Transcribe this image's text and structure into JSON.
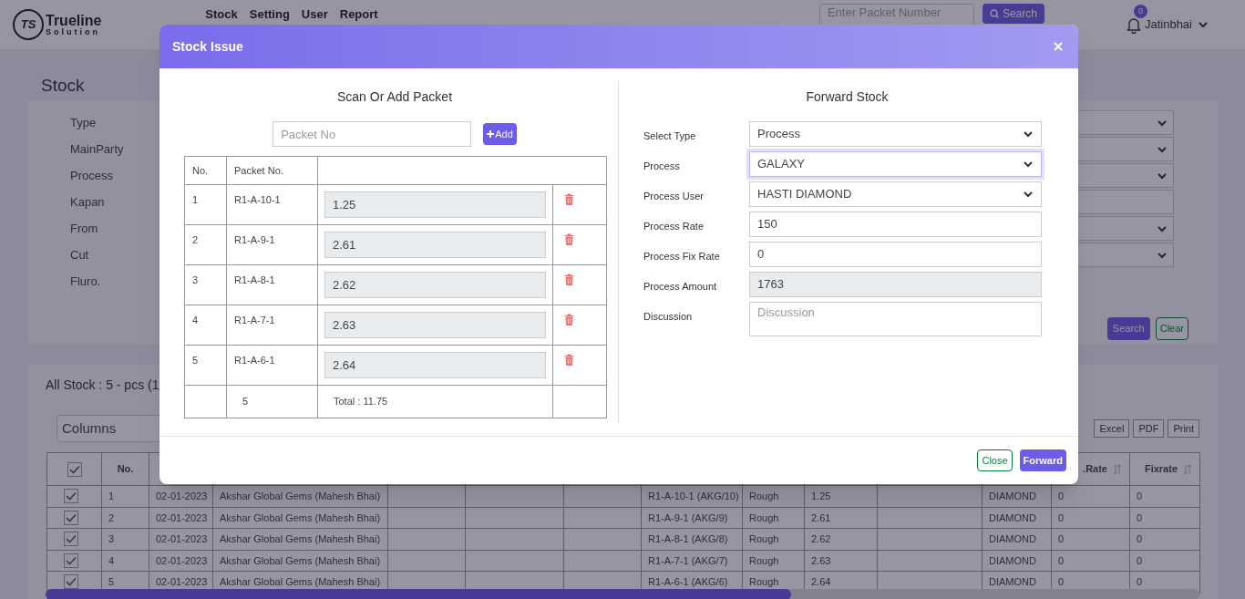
{
  "header": {
    "logo_mark": "TS",
    "logo_title": "Trueline",
    "logo_subtitle": "Solution",
    "nav": [
      "Stock",
      "Setting",
      "User",
      "Report"
    ],
    "search": {
      "placeholder": "Enter Packet Number"
    },
    "search_button": "Search",
    "notification_count": "0",
    "user": "Jatinbhai"
  },
  "page_title": "Stock",
  "filters": [
    {
      "label": "Type",
      "kind": "select"
    },
    {
      "label": "MainParty",
      "kind": "select"
    },
    {
      "label": "Process",
      "kind": "select"
    },
    {
      "label": "Kapan",
      "kind": "input"
    },
    {
      "label": "From",
      "kind": "select"
    },
    {
      "label": "Cut",
      "kind": "select"
    },
    {
      "label": "Fluro.",
      "kind": "none"
    }
  ],
  "filter_buttons": [
    {
      "kind": "primary",
      "label": "Search"
    },
    {
      "kind": "outline",
      "label": "Clear"
    }
  ],
  "stock": {
    "summary": "All Stock : 5 - pcs (1",
    "columns_select": "Columns",
    "export_buttons": [
      "Excel",
      "PDF",
      "Print"
    ],
    "select_all": {
      "checked": true
    },
    "columns": [
      {
        "kind": "text",
        "label": "No."
      },
      {
        "kind": "covered"
      },
      {
        "kind": "covered"
      },
      {
        "kind": "covered"
      },
      {
        "kind": "covered"
      },
      {
        "kind": "covered"
      },
      {
        "kind": "covered"
      },
      {
        "kind": "covered"
      },
      {
        "kind": "covered"
      },
      {
        "kind": "covered"
      },
      {
        "kind": "covered"
      },
      {
        "kind": "sortable",
        "label": ".Rate"
      },
      {
        "kind": "sortable",
        "label": "Fixrate"
      }
    ],
    "rows": [
      {
        "checked": true,
        "cells": [
          "1",
          "02-01-2023",
          "Akshar Global Gems (Mahesh Bhai)",
          null,
          null,
          null,
          "R1-A-10-1 (AKG/10)",
          "Rough",
          "1.25",
          null,
          "DIAMOND",
          "0",
          "0"
        ]
      },
      {
        "checked": true,
        "cells": [
          "2",
          "02-01-2023",
          "Akshar Global Gems (Mahesh Bhai)",
          null,
          null,
          null,
          "R1-A-9-1 (AKG/9)",
          "Rough",
          "2.61",
          null,
          "DIAMOND",
          "0",
          "0"
        ]
      },
      {
        "checked": true,
        "cells": [
          "3",
          "02-01-2023",
          "Akshar Global Gems (Mahesh Bhai)",
          null,
          null,
          null,
          "R1-A-8-1 (AKG/8)",
          "Rough",
          "2.62",
          null,
          "DIAMOND",
          "0",
          "0"
        ]
      },
      {
        "checked": true,
        "cells": [
          "4",
          "02-01-2023",
          "Akshar Global Gems (Mahesh Bhai)",
          null,
          null,
          null,
          "R1-A-7-1 (AKG/7)",
          "Rough",
          "2.63",
          null,
          "DIAMOND",
          "0",
          "0"
        ]
      },
      {
        "checked": true,
        "cells": [
          "5",
          "02-01-2023",
          "Akshar Global Gems (Mahesh Bhai)",
          null,
          null,
          null,
          "R1-A-6-1 (AKG/6)",
          "Rough",
          "2.64",
          null,
          "DIAMOND",
          "0",
          "0"
        ]
      }
    ]
  },
  "modal": {
    "title": "Stock Issue",
    "left": {
      "title": "Scan Or Add Packet",
      "packet_field": {
        "placeholder": "Packet No"
      },
      "add_button": "Add",
      "columns": [
        "No.",
        "Packet No."
      ],
      "rows": [
        {
          "no": "1",
          "packet": "R1-A-10-1",
          "weight": "1.25"
        },
        {
          "no": "2",
          "packet": "R1-A-9-1",
          "weight": "2.61"
        },
        {
          "no": "3",
          "packet": "R1-A-8-1",
          "weight": "2.62"
        },
        {
          "no": "4",
          "packet": "R1-A-7-1",
          "weight": "2.63"
        },
        {
          "no": "5",
          "packet": "R1-A-6-1",
          "weight": "2.64"
        }
      ],
      "total_count": "5",
      "total": "Total : 11.75"
    },
    "right": {
      "title": "Forward Stock",
      "fields": [
        {
          "kind": "select",
          "label": "Select Type",
          "value": "Process",
          "focused": false,
          "disabled": false
        },
        {
          "kind": "select",
          "label": "Process",
          "value": "GALAXY",
          "focused": true,
          "disabled": false
        },
        {
          "kind": "select",
          "label": "Process User",
          "value": "HASTI DIAMOND",
          "focused": false,
          "disabled": false
        },
        {
          "kind": "input",
          "label": "Process Rate",
          "value": "150",
          "focused": false,
          "disabled": false
        },
        {
          "kind": "input",
          "label": "Process Fix Rate",
          "value": "0",
          "focused": false,
          "disabled": false
        },
        {
          "kind": "input",
          "label": "Process Amount",
          "value": "1763",
          "focused": false,
          "disabled": true
        },
        {
          "kind": "textarea",
          "label": "Discussion",
          "placeholder": "Discussion",
          "focused": false,
          "disabled": false
        }
      ]
    },
    "buttons": [
      {
        "kind": "outline",
        "label": "Close"
      },
      {
        "kind": "primary",
        "label": "Forward"
      }
    ]
  }
}
